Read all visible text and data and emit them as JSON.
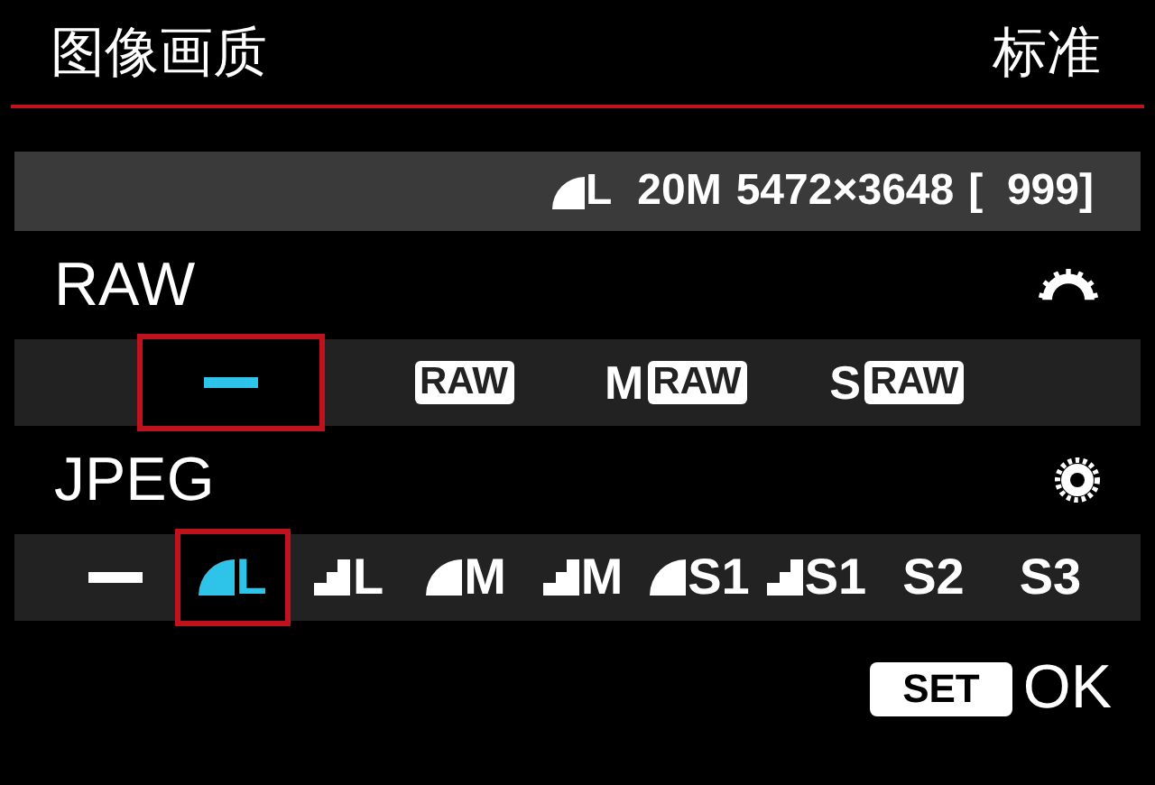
{
  "header": {
    "title": "图像画质",
    "mode": "标准"
  },
  "info": {
    "fine": true,
    "size": "L",
    "megapixels": "20M",
    "resolution": "5472×3648",
    "shots": "[  999]"
  },
  "raw": {
    "label": "RAW",
    "options": [
      {
        "kind": "none",
        "selected": true
      },
      {
        "kind": "raw",
        "label": "RAW",
        "selected": false
      },
      {
        "kind": "raw",
        "prefix": "M",
        "label": "RAW",
        "selected": false
      },
      {
        "kind": "raw",
        "prefix": "S",
        "label": "RAW",
        "selected": false
      }
    ]
  },
  "jpeg": {
    "label": "JPEG",
    "options": [
      {
        "kind": "none",
        "selected": false
      },
      {
        "kind": "fine",
        "size": "L",
        "selected": true
      },
      {
        "kind": "normal",
        "size": "L",
        "selected": false
      },
      {
        "kind": "fine",
        "size": "M",
        "selected": false
      },
      {
        "kind": "normal",
        "size": "M",
        "selected": false
      },
      {
        "kind": "fine",
        "size": "S1",
        "selected": false
      },
      {
        "kind": "normal",
        "size": "S1",
        "selected": false
      },
      {
        "kind": "plain",
        "size": "S2",
        "selected": false
      },
      {
        "kind": "plain",
        "size": "S3",
        "selected": false
      }
    ]
  },
  "footer": {
    "key": "SET",
    "action": "OK"
  }
}
